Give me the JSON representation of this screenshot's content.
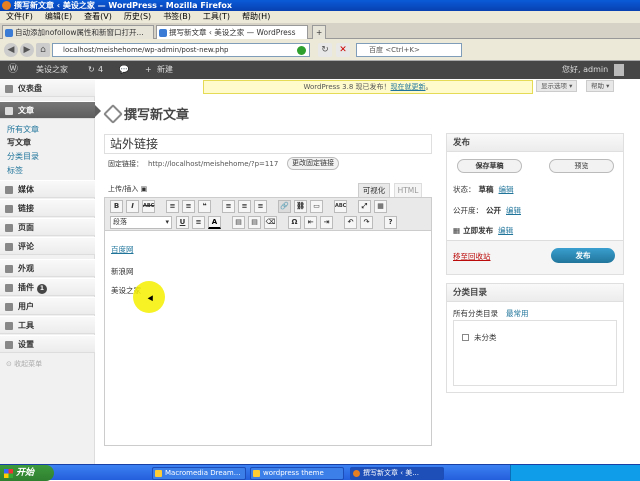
{
  "browser": {
    "window_title": "撰写新文章 ‹ 美设之家 — WordPress - Mozilla Firefox",
    "menu": [
      "文件(F)",
      "编辑(E)",
      "查看(V)",
      "历史(S)",
      "书签(B)",
      "工具(T)",
      "帮助(H)"
    ],
    "tabs": [
      {
        "label": "自动添加nofollow属性和新窗口打开..."
      },
      {
        "label": "撰写新文章 ‹ 美设之家 — WordPress"
      }
    ],
    "url": "localhost/meishehome/wp-admin/post-new.php",
    "search_placeholder": "百度 <Ctrl+K>"
  },
  "adminbar": {
    "site_name": "美设之家",
    "updates_count": "4",
    "new_label": "新建",
    "greeting": "您好, admin"
  },
  "sidebar": {
    "dashboard": "仪表盘",
    "posts": "文章",
    "posts_sub": [
      "所有文章",
      "写文章",
      "分类目录",
      "标签"
    ],
    "media": "媒体",
    "links": "链接",
    "pages": "页面",
    "comments": "评论",
    "appearance": "外观",
    "plugins": "插件",
    "plugins_badge": "1",
    "users": "用户",
    "tools": "工具",
    "settings": "设置",
    "collapse": "收起菜单"
  },
  "notice": {
    "text": "WordPress 3.8 现已发布！",
    "link": "现在就更新",
    "end": "。"
  },
  "screen_options": "显示选项",
  "help": "帮助",
  "page_title": "撰写新文章",
  "editor": {
    "post_title": "站外链接",
    "permalink_label": "固定链接：",
    "permalink_url": "http://localhost/meishehome/?p=117",
    "permalink_button": "更改固定链接",
    "upload_label": "上传/插入",
    "tab_visual": "可视化",
    "tab_html": "HTML",
    "format_select": "段落",
    "content_lines": [
      "百度网",
      "新浪网",
      "美设之家"
    ]
  },
  "publish": {
    "title": "发布",
    "save_draft": "保存草稿",
    "preview": "预览",
    "status_label": "状态：",
    "status_value": "草稿",
    "visibility_label": "公开度：",
    "visibility_value": "公开",
    "schedule_label": "立即发布",
    "edit": "编辑",
    "trash": "移至回收站",
    "publish_button": "发布"
  },
  "categories": {
    "title": "分类目录",
    "tab_all": "所有分类目录",
    "tab_popular": "最常用",
    "items": [
      "未分类"
    ]
  },
  "taskbar": {
    "start": "开始",
    "tasks": [
      "Macromedia Dream...",
      "wordpress theme",
      "撰写新文章 ‹ 美..."
    ]
  },
  "toolbar1_icons": [
    "B",
    "I",
    "ABC",
    "≡",
    "≡",
    "❝",
    "≡",
    "≡",
    "≡",
    "🔗",
    "⛓",
    "▭",
    "ABC",
    "⤢",
    "▦"
  ],
  "toolbar2_icons": [
    "U",
    "≡",
    "A",
    "▤",
    "▤",
    "⌫",
    "Ω",
    "⇤",
    "⇥",
    "↶",
    "↷",
    "?"
  ]
}
